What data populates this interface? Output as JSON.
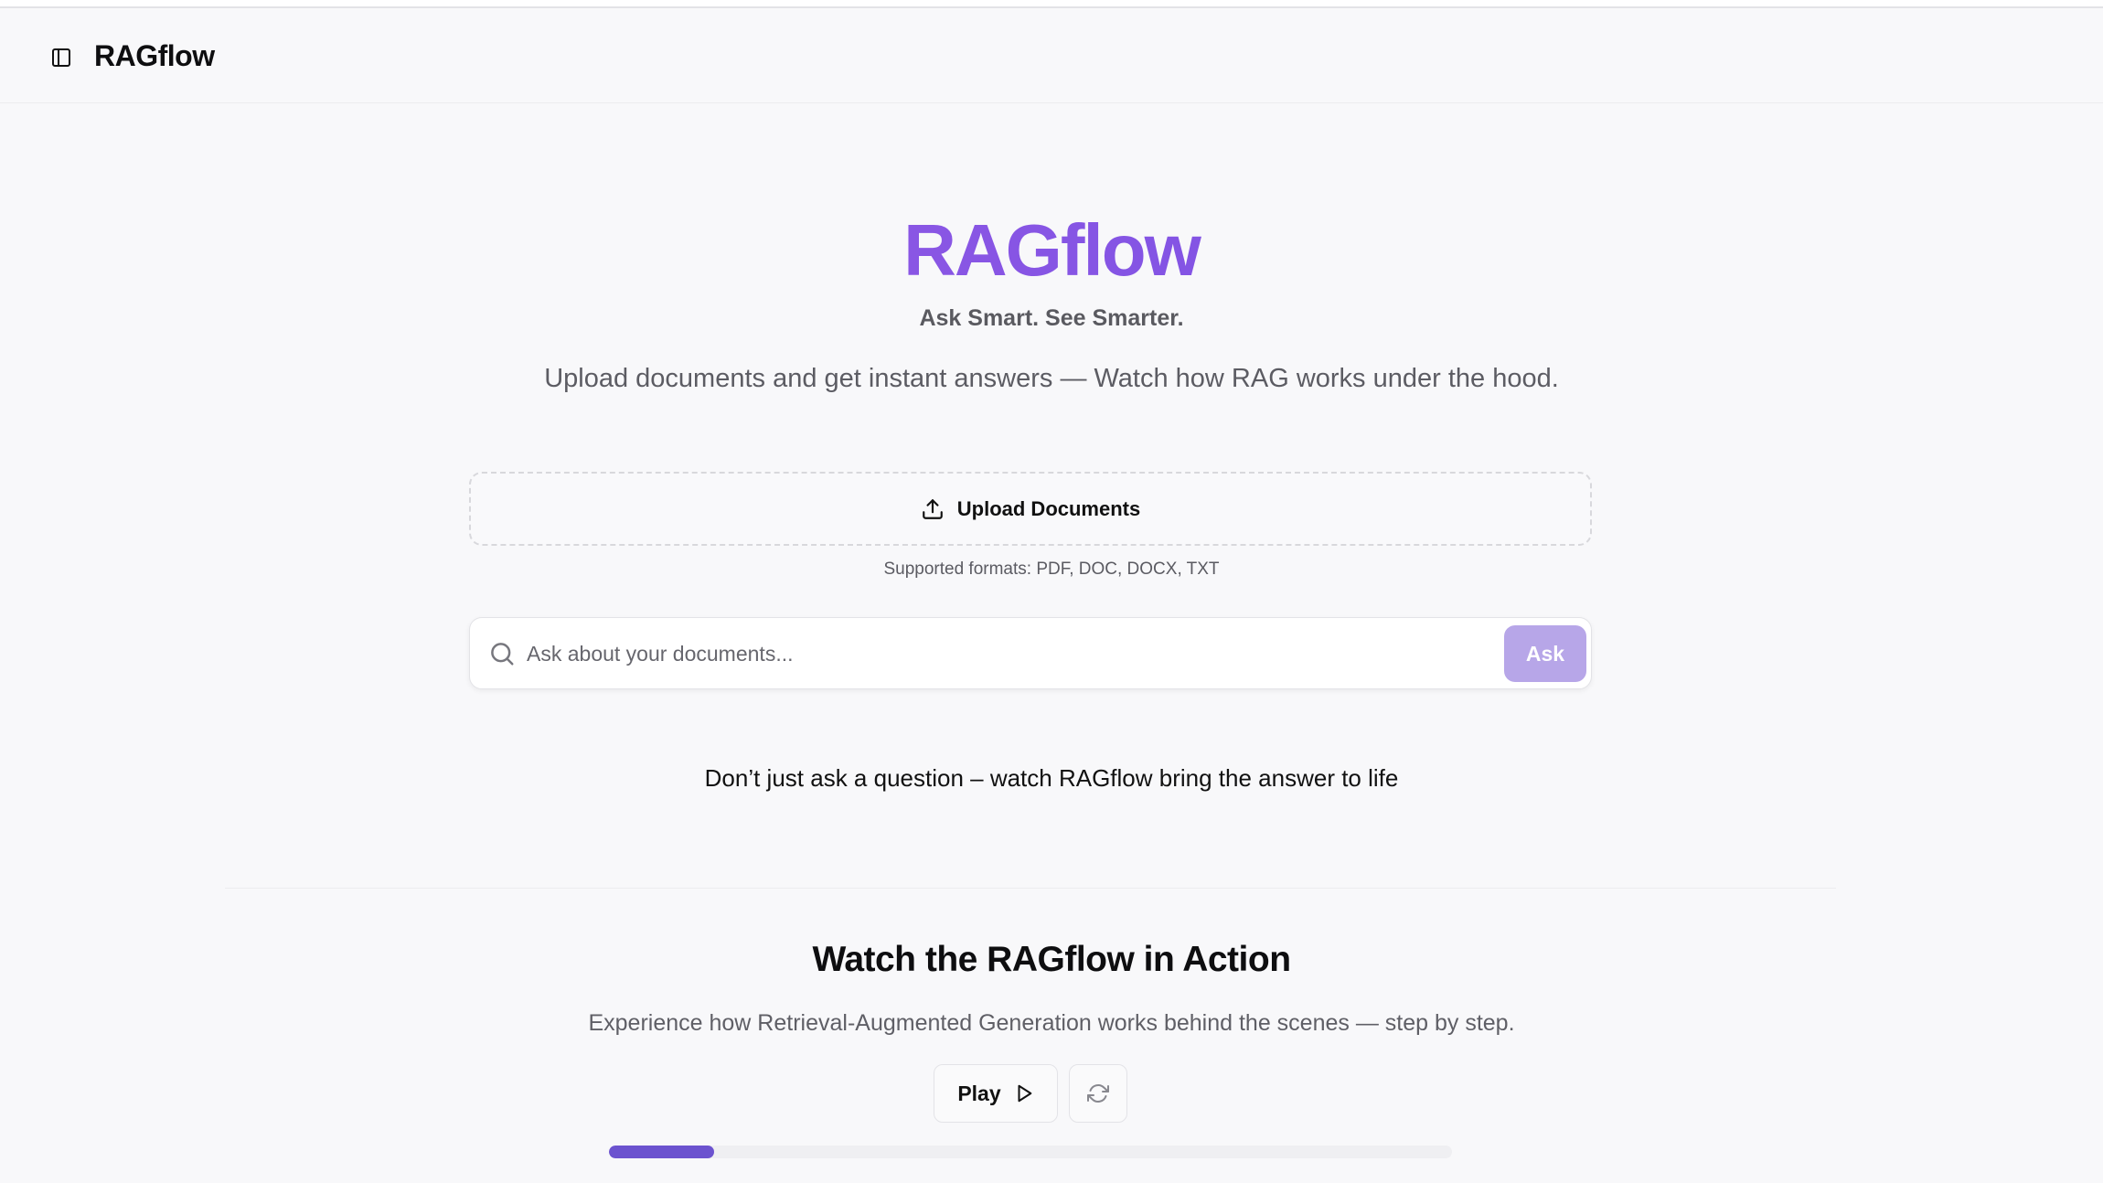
{
  "header": {
    "title": "RAGflow",
    "toggle_icon": "sidebar-toggle-icon"
  },
  "hero": {
    "title": "RAGflow",
    "tagline": "Ask Smart. See Smarter.",
    "description": "Upload documents and get instant answers — Watch how RAG works under the hood.",
    "title_color": "#7c56e3"
  },
  "upload": {
    "label": "Upload Documents",
    "icon": "upload-icon",
    "formats": "Supported formats: PDF, DOC, DOCX, TXT"
  },
  "search": {
    "placeholder": "Ask about your documents...",
    "value": "",
    "icon": "search-icon",
    "button_label": "Ask",
    "button_color": "#b7a6e8"
  },
  "cta": {
    "text": "Don’t just ask a question – watch RAGflow bring the answer to life"
  },
  "demo": {
    "title": "Watch the RAGflow in Action",
    "description": "Experience how Retrieval-Augmented Generation works behind the scenes — step by step.",
    "play_label": "Play",
    "play_icon": "play-icon",
    "reset_icon": "refresh-icon",
    "progress_percent": 12.5,
    "progress_color": "#6c53cf"
  }
}
